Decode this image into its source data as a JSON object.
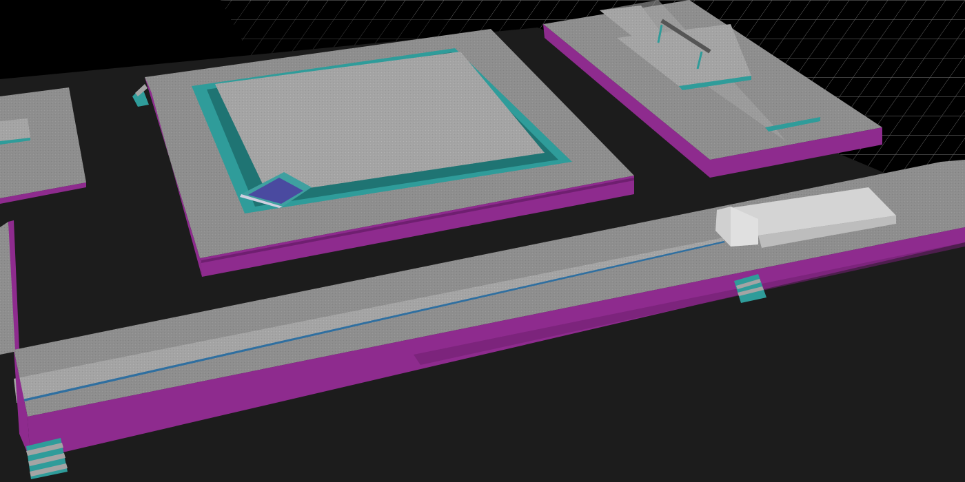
{
  "scene": {
    "view": "3d-perspective-level-editor",
    "grid_visible": true,
    "objects": [
      "ground-slab",
      "left-building-upper",
      "left-wall",
      "central-plaza",
      "plaza-pool",
      "tilted-panel",
      "right-cross-platform",
      "gymnastics-bar",
      "long-walkway",
      "walkway-box-structure",
      "staircase-front",
      "staircase-middle",
      "staircase-back"
    ]
  },
  "colors": {
    "background": "#000000",
    "ground": "#1c1c1c",
    "grid_line": "#8a8a8a",
    "floor_gray": "#8c8c8c",
    "floor_light": "#a2a2a2",
    "side_magenta": "#8e2b8e",
    "side_magenta_dark": "#6f1f70",
    "teal": "#2f9c9a",
    "teal_dark": "#1f7473",
    "box_white": "#d4d4d4",
    "panel_blue": "#4a4aa0"
  }
}
